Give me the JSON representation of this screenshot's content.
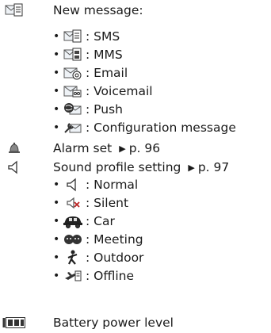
{
  "new_message": {
    "title": "New message:",
    "items": [
      {
        "icon": "sms-envelope-icon",
        "label": ": SMS"
      },
      {
        "icon": "mms-envelope-icon",
        "label": ": MMS"
      },
      {
        "icon": "email-envelope-icon",
        "label": ": Email"
      },
      {
        "icon": "voicemail-envelope-icon",
        "label": ": Voicemail"
      },
      {
        "icon": "push-globe-icon",
        "label": ": Push"
      },
      {
        "icon": "configuration-wrench-icon",
        "label": ": Configuration message"
      }
    ]
  },
  "alarm": {
    "label": "Alarm set",
    "ref": "p. 96"
  },
  "sound_profile": {
    "label": "Sound profile setting",
    "ref": "p. 97",
    "items": [
      {
        "icon": "speaker-icon",
        "label": ": Normal"
      },
      {
        "icon": "speaker-muted-icon",
        "label": ": Silent"
      },
      {
        "icon": "car-icon",
        "label": ": Car"
      },
      {
        "icon": "meeting-faces-icon",
        "label": ": Meeting"
      },
      {
        "icon": "outdoor-walker-icon",
        "label": ": Outdoor"
      },
      {
        "icon": "offline-airplane-icon",
        "label": ": Offline"
      }
    ]
  },
  "battery": {
    "label": "Battery power level"
  },
  "bullet_char": "•",
  "arrow_char": "▶"
}
